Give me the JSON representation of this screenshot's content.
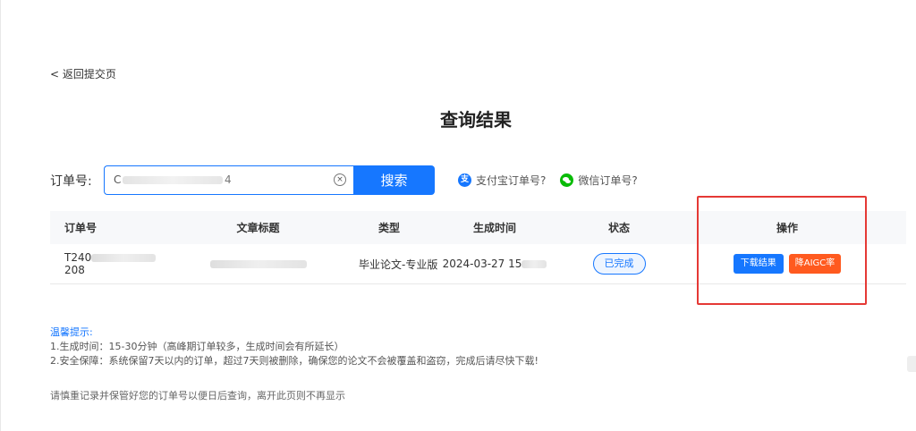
{
  "nav": {
    "back_label": "< 返回提交页"
  },
  "page": {
    "title": "查询结果"
  },
  "search": {
    "label": "订单号:",
    "value": "C",
    "value_tail": "4",
    "button_label": "搜索",
    "alipay_help": "支付宝订单号?",
    "wechat_help": "微信订单号?"
  },
  "table": {
    "headers": [
      "订单号",
      "文章标题",
      "类型",
      "生成时间",
      "状态",
      "操作"
    ],
    "rows": [
      {
        "order_no": "T240",
        "order_no_tail": "208",
        "type": "毕业论文-专业版",
        "time": "2024-03-27 15",
        "status": "已完成",
        "actions": {
          "download": "下载结果",
          "reduce": "降AIGC率"
        }
      }
    ]
  },
  "tips": {
    "title": "温馨提示:",
    "line1": "1.生成时间：15-30分钟（高峰期订单较多，生成时间会有所延长）",
    "line2": "2.安全保障：系统保留7天以内的订单，超过7天则被删除，确保您的论文不会被覆盖和盗窃，完成后请尽快下载!",
    "note": "请慎重记录并保管好您的订单号以便日后查询，离开此页则不再显示"
  },
  "colors": {
    "accent": "#1677ff",
    "orange": "#ff5a1f",
    "highlight": "#e53935"
  }
}
